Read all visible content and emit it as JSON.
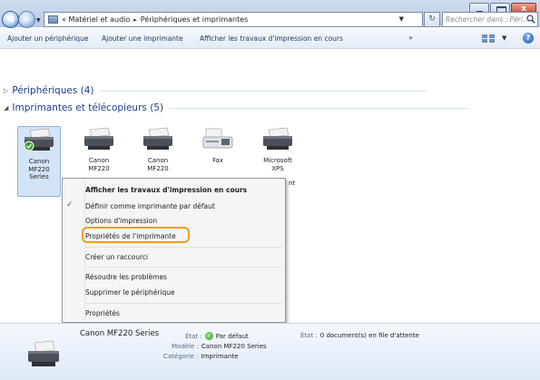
{
  "window": {
    "min_label": "",
    "max_label": "",
    "close_label": "x"
  },
  "address_bar": {
    "crumbs": [
      "« Matériel et audio",
      "Périphériques et imprimantes"
    ],
    "separator": "▸",
    "search_placeholder": "Rechercher dans : Péri..."
  },
  "toolbar": {
    "add_device": "Ajouter un périphérique",
    "add_printer": "Ajouter une imprimante",
    "view_print_jobs": "Afficher les travaux d'impression en cours",
    "more": "»",
    "help": "?"
  },
  "groups": {
    "devices": "Périphériques (4)",
    "printers": "Imprimantes et télécopieurs (5)"
  },
  "printers": [
    {
      "line1": "Canon",
      "line2": "MF220",
      "line3": "Series"
    },
    {
      "line1": "Canon",
      "line2": "MF220",
      "line3": ""
    },
    {
      "line1": "Canon",
      "line2": "MF220",
      "line3": ""
    },
    {
      "line1": "Fax",
      "line2": "",
      "line3": ""
    },
    {
      "line1": "Microsoft",
      "line2": "XPS",
      "line3": ""
    }
  ],
  "peek_text": "nt",
  "context_menu": {
    "items": [
      "Afficher les travaux d'impression en cours",
      "Définir comme imprimante par défaut",
      "Options d'impression",
      "Propriétés de l'imprimante",
      "Créer un raccourci",
      "Résoudre les problèmes",
      "Supprimer le périphérique",
      "Propriétés"
    ],
    "check": "✓"
  },
  "details": {
    "name": "Canon MF220 Series",
    "state_key": "État :",
    "state_value": "Par défaut",
    "model_key": "Modèle :",
    "model_value": "Canon MF220 Series",
    "category_key": "Catégorie :",
    "category_value": "Imprimante",
    "queue_key": "État :",
    "queue_value": "0 document(s) en file d'attente"
  },
  "colors": {
    "highlight_ring": "#ef9d1f",
    "group_heading": "#1e3c8c",
    "selection": "#d4e4f7"
  }
}
